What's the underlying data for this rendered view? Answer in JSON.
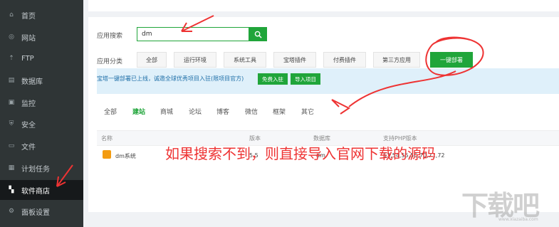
{
  "sidebar": {
    "items": [
      {
        "label": "首页",
        "icon": "home-icon"
      },
      {
        "label": "网站",
        "icon": "globe-icon"
      },
      {
        "label": "FTP",
        "icon": "ftp-icon"
      },
      {
        "label": "数据库",
        "icon": "database-icon"
      },
      {
        "label": "监控",
        "icon": "monitor-icon"
      },
      {
        "label": "安全",
        "icon": "shield-icon"
      },
      {
        "label": "文件",
        "icon": "folder-icon"
      },
      {
        "label": "计划任务",
        "icon": "calendar-icon"
      },
      {
        "label": "软件商店",
        "icon": "grid-icon"
      },
      {
        "label": "面板设置",
        "icon": "settings-icon"
      }
    ],
    "active_index": 8
  },
  "search": {
    "label": "应用搜索",
    "value": "dm"
  },
  "category": {
    "label": "应用分类",
    "items": [
      "全部",
      "运行环境",
      "系统工具",
      "宝塔插件",
      "付费插件",
      "第三方应用",
      "一键部署"
    ],
    "active": "一键部署"
  },
  "notice": {
    "text": "宝塔一键部署已上线，诚邀全球优秀项目入驻(限项目官方)",
    "btn_free": "免费入驻",
    "btn_import": "导入项目"
  },
  "tabs": [
    "全部",
    "建站",
    "商城",
    "论坛",
    "博客",
    "微信",
    "框架",
    "其它"
  ],
  "active_tab": "建站",
  "table": {
    "headers": {
      "name": "名称",
      "version": "版本",
      "db": "数据库",
      "php": "支持PHP版本"
    },
    "rows": [
      {
        "name": "dm系统",
        "version": "5.5",
        "db": "dm",
        "php": "53,54,55,56,70,71,72"
      }
    ]
  },
  "annotation": "如果搜索不到，则直接导入官网下载的源码",
  "watermark": {
    "main": "下载吧",
    "sub": "www.xiazaiba.com"
  },
  "colors": {
    "accent": "#20a53a",
    "sidebar_bg": "#2f3536",
    "annotation": "#e33333"
  }
}
